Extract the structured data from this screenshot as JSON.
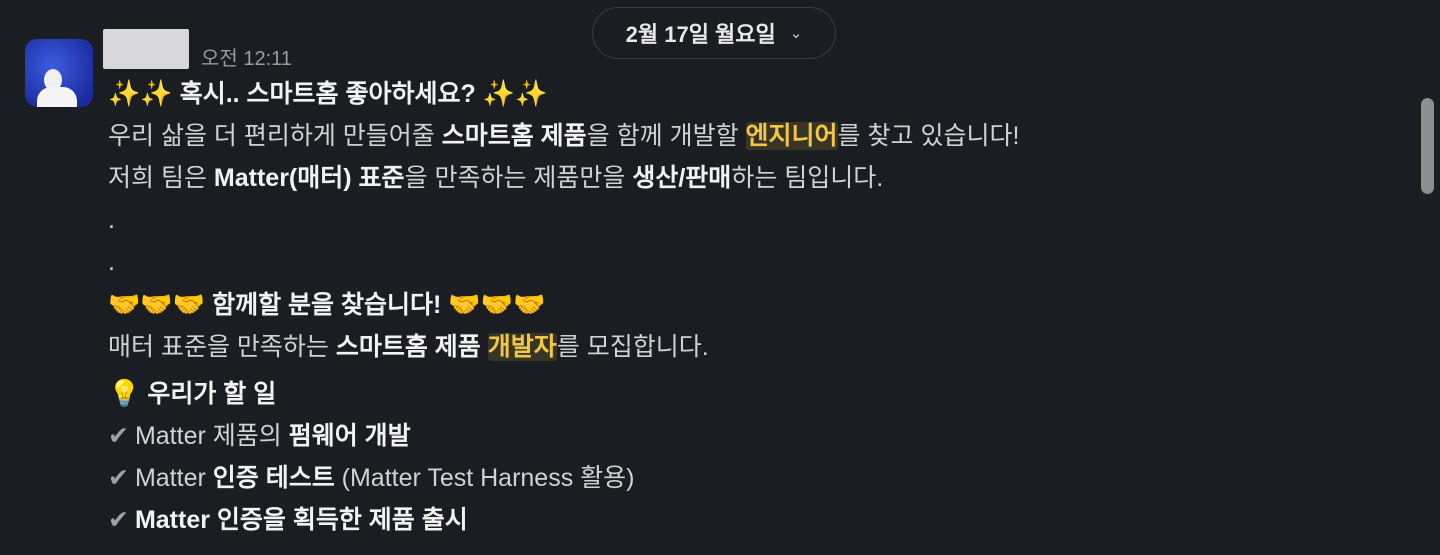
{
  "date_divider": {
    "label": "2월 17일 월요일",
    "chevron_icon": "chevron-down-icon"
  },
  "message": {
    "time": "오전 12:11",
    "heading1": {
      "emoji_left": "✨✨",
      "text": "혹시.. 스마트홈 좋아하세요?",
      "emoji_right": "✨✨"
    },
    "p1": {
      "t1": "우리 삶을 더 편리하게 만들어줄 ",
      "b1": "스마트홈 제품",
      "t2": "을 함께 개발할 ",
      "h1": "엔지니어",
      "t3": "를 찾고 있습니다!"
    },
    "p2": {
      "t1": "저희 팀은 ",
      "b1": "Matter(매터) 표준",
      "t2": "을 만족하는 제품만을 ",
      "b2": "생산/판매",
      "t3": "하는 팀입니다."
    },
    "dot1": ".",
    "dot2": ".",
    "heading2": {
      "emoji_left": "🤝🤝🤝",
      "text": "함께할 분을 찾습니다!",
      "emoji_right": "🤝🤝🤝"
    },
    "p3": {
      "t1": "매터 표준을 만족하는 ",
      "b1": "스마트홈 제품 ",
      "h1": "개발자",
      "t2": "를 모집합니다."
    },
    "heading3": {
      "emoji": "💡",
      "text": "우리가 할 일"
    },
    "tasks": [
      {
        "check": "✔",
        "t1": "Matter 제품의 ",
        "b1": "펌웨어 개발",
        "t2": ""
      },
      {
        "check": "✔",
        "t1": "Matter ",
        "b1": "인증 테스트",
        "t2": " (Matter Test Harness 활용)"
      },
      {
        "check": "✔",
        "t1": "",
        "b1": "Matter 인증을 획득한 제품 출시",
        "t2": ""
      }
    ]
  },
  "colors": {
    "background": "#1a1d21",
    "text": "#d1d2d3",
    "highlight": "#f2c744",
    "timestamp": "#9a9b9d"
  }
}
